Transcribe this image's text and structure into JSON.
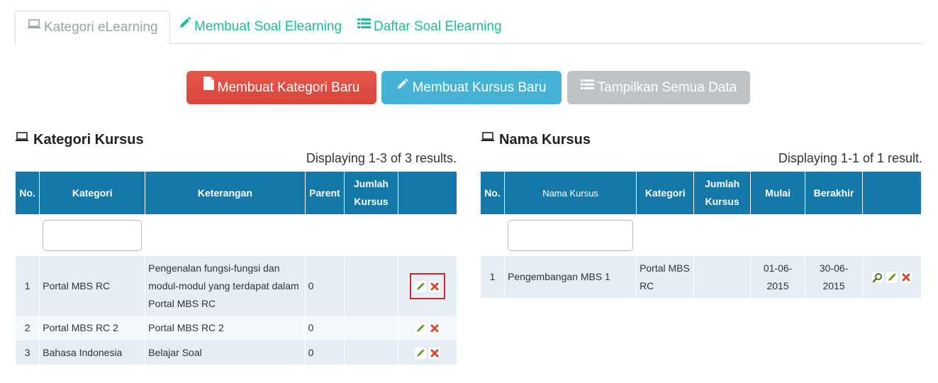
{
  "tabs": [
    {
      "label": "Kategori eLearning",
      "icon": "laptop-icon",
      "active": true
    },
    {
      "label": "Membuat Soal Elearning",
      "icon": "pencil-icon"
    },
    {
      "label": "Daftar Soal Elearning",
      "icon": "list-icon"
    }
  ],
  "buttons": {
    "new_category": "Membuat Kategori Baru",
    "new_course": "Membuat Kursus Baru",
    "show_all": "Tampilkan Semua Data"
  },
  "colors": {
    "accent": "#1abc9c",
    "header": "#1478a8",
    "btn_red": "#e74c3c",
    "btn_blue": "#46b3d6",
    "btn_gray": "#bdc3c7",
    "highlight": "#d62424"
  },
  "categories": {
    "title": "Kategori Kursus",
    "summary": "Displaying 1-3 of 3 results.",
    "columns": [
      "No.",
      "Kategori",
      "Keterangan",
      "Parent",
      "Jumlah Kursus",
      ""
    ],
    "filter_value": "",
    "rows": [
      {
        "no": "1",
        "kategori": "Portal MBS RC",
        "keterangan": "Pengenalan fungsi-fungsi dan modul-modul yang  terdapat dalam Portal MBS RC",
        "parent": "0",
        "jumlah": ""
      },
      {
        "no": "2",
        "kategori": "Portal MBS RC 2",
        "keterangan": "Portal MBS RC 2",
        "parent": "0",
        "jumlah": ""
      },
      {
        "no": "3",
        "kategori": "Bahasa Indonesia",
        "keterangan": "Belajar Soal",
        "parent": "0",
        "jumlah": ""
      }
    ]
  },
  "courses": {
    "title": "Nama Kursus",
    "summary": "Displaying 1-1 of 1 result.",
    "columns": [
      "No.",
      "Nama Kursus",
      "Kategori",
      "Jumlah Kursus",
      "Mulai",
      "Berakhir",
      ""
    ],
    "filter_value": "",
    "rows": [
      {
        "no": "1",
        "nama": "Pengembangan MBS 1",
        "kategori": "Portal MBS RC",
        "jumlah": "",
        "mulai": "01-06-2015",
        "berakhir": "30-06-2015"
      }
    ]
  }
}
